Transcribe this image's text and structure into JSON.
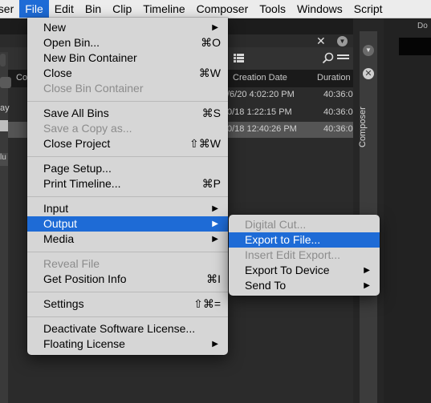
{
  "menubar": {
    "items": [
      "oser",
      "File",
      "Edit",
      "Bin",
      "Clip",
      "Timeline",
      "Composer",
      "Tools",
      "Windows",
      "Script"
    ],
    "active_index": 1
  },
  "bin": {
    "close_glyph": "✕",
    "columns": [
      "Co",
      "Creation Date",
      "Duration"
    ],
    "rows": [
      {
        "date": "/6/20 4:02:20 PM",
        "duration": "40:36:0"
      },
      {
        "date": "0/18 1:22:15 PM",
        "duration": "40:36:0"
      },
      {
        "date": "0/18 12:40:26 PM",
        "duration": "40:36:0"
      }
    ],
    "left_fragment": "ay",
    "left_fragment2": "lu"
  },
  "composer": {
    "label": "Composer"
  },
  "right_panel": {
    "title": "Do"
  },
  "file_menu": {
    "groups": [
      [
        {
          "label": "New",
          "shortcut": "",
          "submenu": true,
          "disabled": false
        },
        {
          "label": "Open Bin...",
          "shortcut": "⌘O",
          "submenu": false,
          "disabled": false
        },
        {
          "label": "New Bin Container",
          "shortcut": "",
          "submenu": false,
          "disabled": false
        },
        {
          "label": "Close",
          "shortcut": "⌘W",
          "submenu": false,
          "disabled": false
        },
        {
          "label": "Close Bin Container",
          "shortcut": "",
          "submenu": false,
          "disabled": true
        }
      ],
      [
        {
          "label": "Save All Bins",
          "shortcut": "⌘S",
          "submenu": false,
          "disabled": false
        },
        {
          "label": "Save a Copy as...",
          "shortcut": "",
          "submenu": false,
          "disabled": true
        },
        {
          "label": "Close Project",
          "shortcut": "⇧⌘W",
          "submenu": false,
          "disabled": false
        }
      ],
      [
        {
          "label": "Page Setup...",
          "shortcut": "",
          "submenu": false,
          "disabled": false
        },
        {
          "label": "Print Timeline...",
          "shortcut": "⌘P",
          "submenu": false,
          "disabled": false
        }
      ],
      [
        {
          "label": "Input",
          "shortcut": "",
          "submenu": true,
          "disabled": false
        },
        {
          "label": "Output",
          "shortcut": "",
          "submenu": true,
          "disabled": false,
          "highlighted": true
        },
        {
          "label": "Media",
          "shortcut": "",
          "submenu": true,
          "disabled": false
        }
      ],
      [
        {
          "label": "Reveal File",
          "shortcut": "",
          "submenu": false,
          "disabled": true
        },
        {
          "label": "Get Position Info",
          "shortcut": "⌘I",
          "submenu": false,
          "disabled": false
        }
      ],
      [
        {
          "label": "Settings",
          "shortcut": "⇧⌘=",
          "submenu": false,
          "disabled": false
        }
      ],
      [
        {
          "label": "Deactivate Software License...",
          "shortcut": "",
          "submenu": false,
          "disabled": false
        },
        {
          "label": "Floating License",
          "shortcut": "",
          "submenu": true,
          "disabled": false
        }
      ]
    ]
  },
  "output_menu": {
    "items": [
      {
        "label": "Digital Cut...",
        "submenu": false,
        "disabled": true
      },
      {
        "label": "Export to File...",
        "submenu": false,
        "disabled": false,
        "highlighted": true
      },
      {
        "label": "Insert Edit Export...",
        "submenu": false,
        "disabled": true
      },
      {
        "label": "Export To Device",
        "submenu": true,
        "disabled": false
      },
      {
        "label": "Send To",
        "submenu": true,
        "disabled": false
      }
    ]
  },
  "colors": {
    "highlight": "#1e6bd6",
    "menu_bg": "#d6d6d6"
  }
}
